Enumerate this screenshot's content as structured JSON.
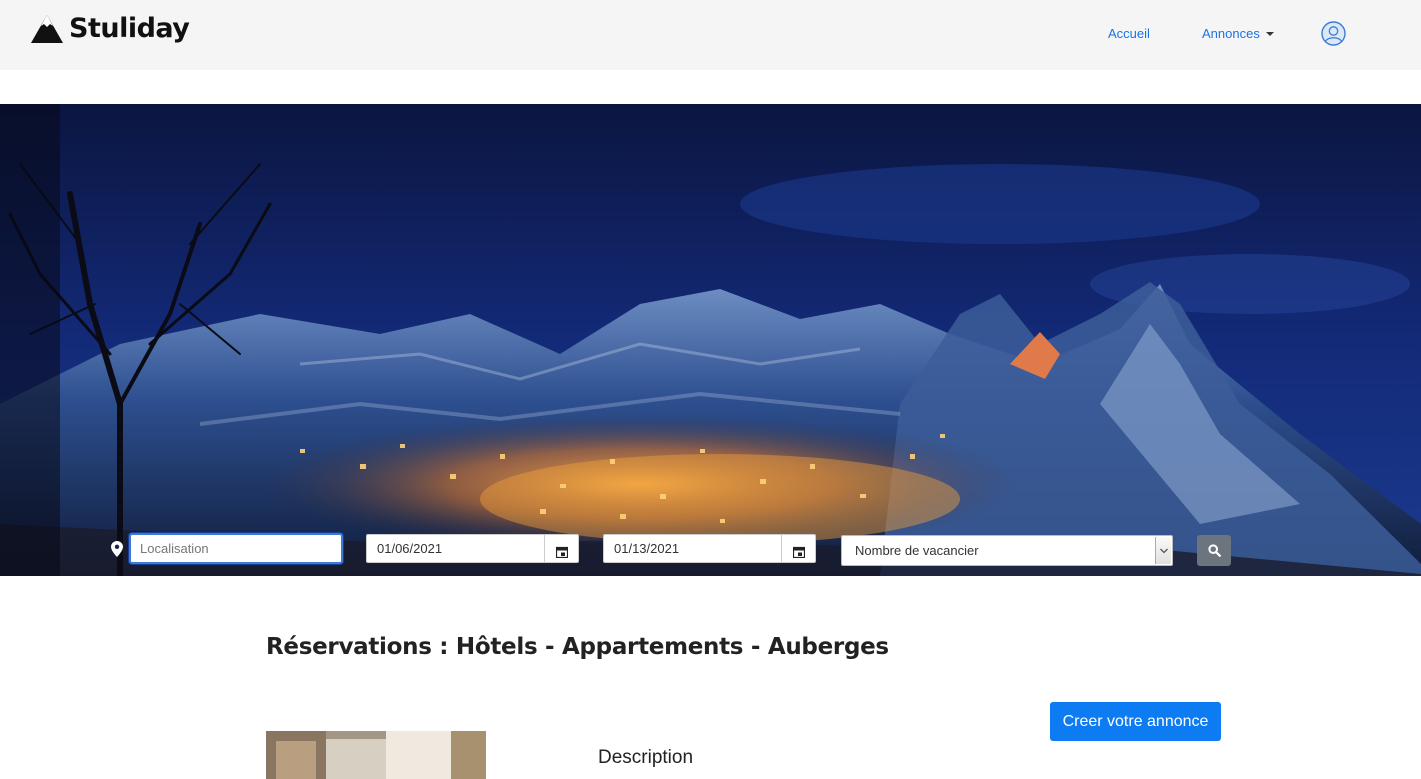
{
  "brand": {
    "name": "Stuliday"
  },
  "nav": {
    "home_label": "Accueil",
    "ads_label": "Annonces"
  },
  "search": {
    "location_placeholder": "Localisation",
    "start_date": "01/06/2021",
    "end_date": "01/13/2021",
    "guests_selected": "Nombre de vacancier"
  },
  "main": {
    "title": "Réservations : Hôtels - Appartements - Auberges",
    "create_button_label": "Creer votre annonce",
    "description_label": "Description"
  },
  "colors": {
    "nav_link": "#1a73e8",
    "cta": "#0d7bf2",
    "search_button": "#6c757d",
    "navbar_bg": "#f5f5f5"
  },
  "icons": [
    "mountain-logo-icon",
    "user-avatar-icon",
    "location-pin-icon",
    "calendar-icon",
    "chevron-down-icon",
    "search-icon"
  ]
}
